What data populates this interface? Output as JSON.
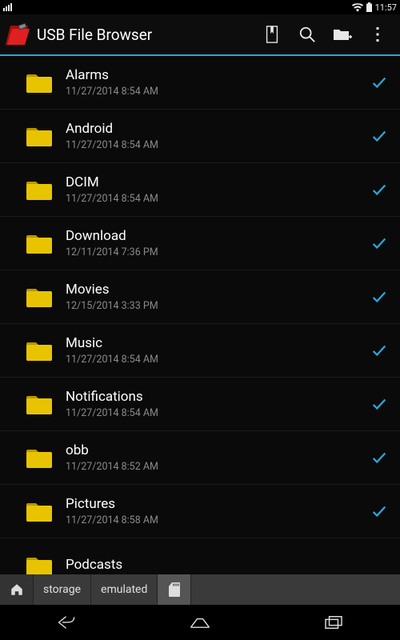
{
  "status": {
    "time": "11:57"
  },
  "header": {
    "title": "USB File Browser"
  },
  "files": [
    {
      "name": "Alarms",
      "date": "11/27/2014 8:54 AM",
      "checked": true
    },
    {
      "name": "Android",
      "date": "11/27/2014 8:54 AM",
      "checked": true
    },
    {
      "name": "DCIM",
      "date": "11/27/2014 8:54 AM",
      "checked": true
    },
    {
      "name": "Download",
      "date": "12/11/2014 7:36 PM",
      "checked": true
    },
    {
      "name": "Movies",
      "date": "12/15/2014 3:33 PM",
      "checked": true
    },
    {
      "name": "Music",
      "date": "11/27/2014 8:54 AM",
      "checked": true
    },
    {
      "name": "Notifications",
      "date": "11/27/2014 8:54 AM",
      "checked": true
    },
    {
      "name": "obb",
      "date": "11/27/2014 8:52 AM",
      "checked": true
    },
    {
      "name": "Pictures",
      "date": "11/27/2014 8:58 AM",
      "checked": true
    },
    {
      "name": "Podcasts",
      "date": "",
      "checked": false
    }
  ],
  "breadcrumb": {
    "items": [
      "storage",
      "emulated"
    ]
  },
  "colors": {
    "accent": "#2aa7d8",
    "folder": "#e8c400",
    "folder_shadow": "#b89600"
  }
}
